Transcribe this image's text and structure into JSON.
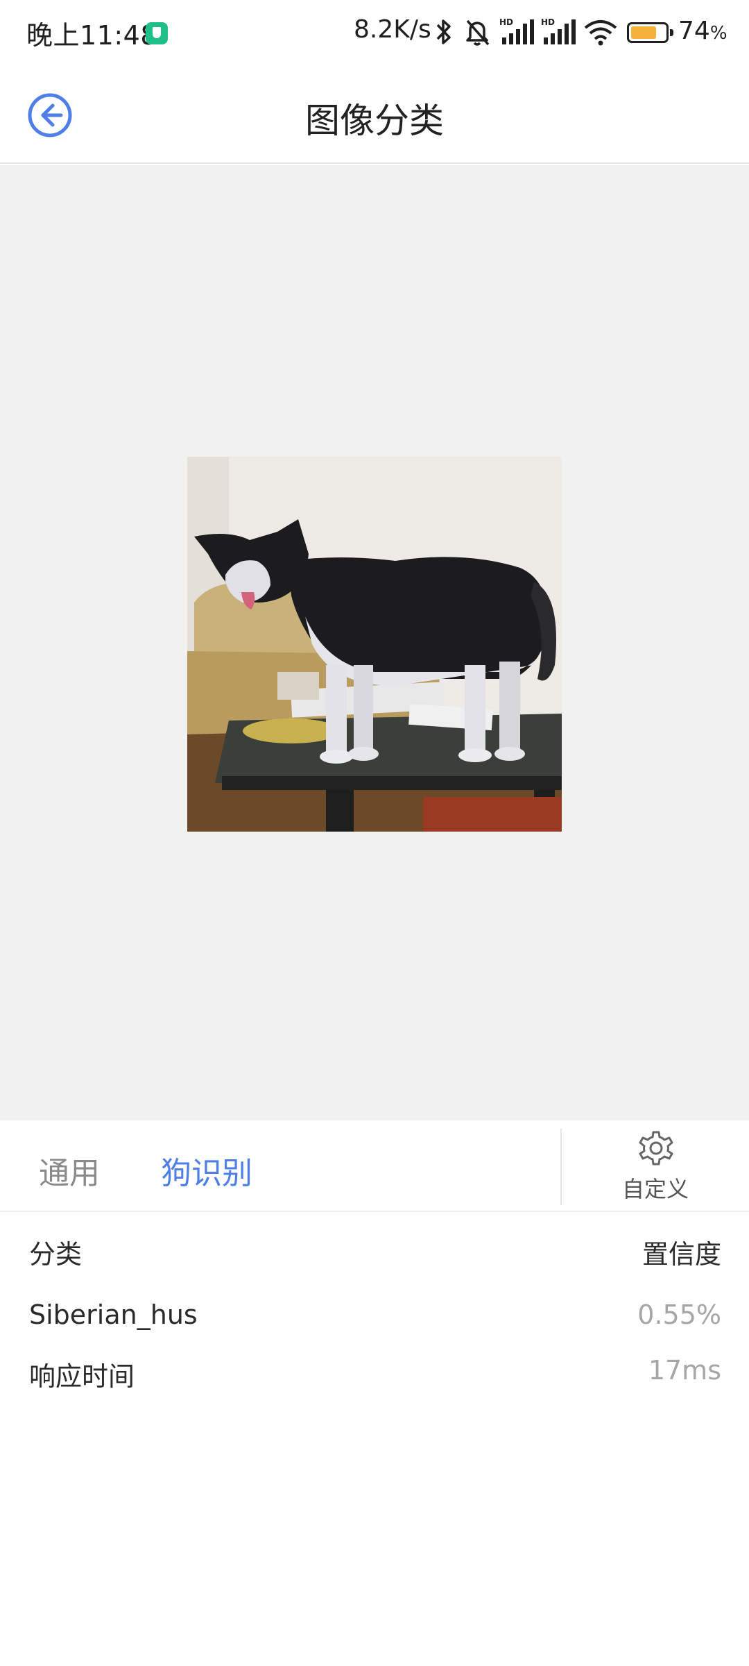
{
  "status_bar": {
    "time": "晚上11:48",
    "net_speed": "8.2K/s",
    "battery_percent": "74",
    "battery_suffix": "%",
    "battery_level": 0.74,
    "battery_color": "#f5b23a",
    "shield_color": "#1fbf8a",
    "icons": [
      "vpn-shield-icon",
      "bluetooth-icon",
      "mute-bell-icon",
      "hd-signal-icon",
      "hd-signal-icon",
      "wifi-icon",
      "battery-icon"
    ]
  },
  "header": {
    "title": "图像分类",
    "back_icon": "back-arrow-icon",
    "accent_color": "#4e7ee6"
  },
  "preview": {
    "background_color": "#f1f1f1"
  },
  "tabs": {
    "items": [
      {
        "label": "通用",
        "active": false
      },
      {
        "label": "狗识别",
        "active": true
      }
    ],
    "custom_label": "自定义",
    "custom_icon": "gear-icon",
    "active_color": "#4e7ee6",
    "inactive_color": "#8a8a8a"
  },
  "results": {
    "header_class": "分类",
    "header_confidence": "置信度",
    "class_name": "Siberian_hus",
    "confidence": "0.55%",
    "latency_label": "响应时间",
    "latency_value": "17ms"
  }
}
